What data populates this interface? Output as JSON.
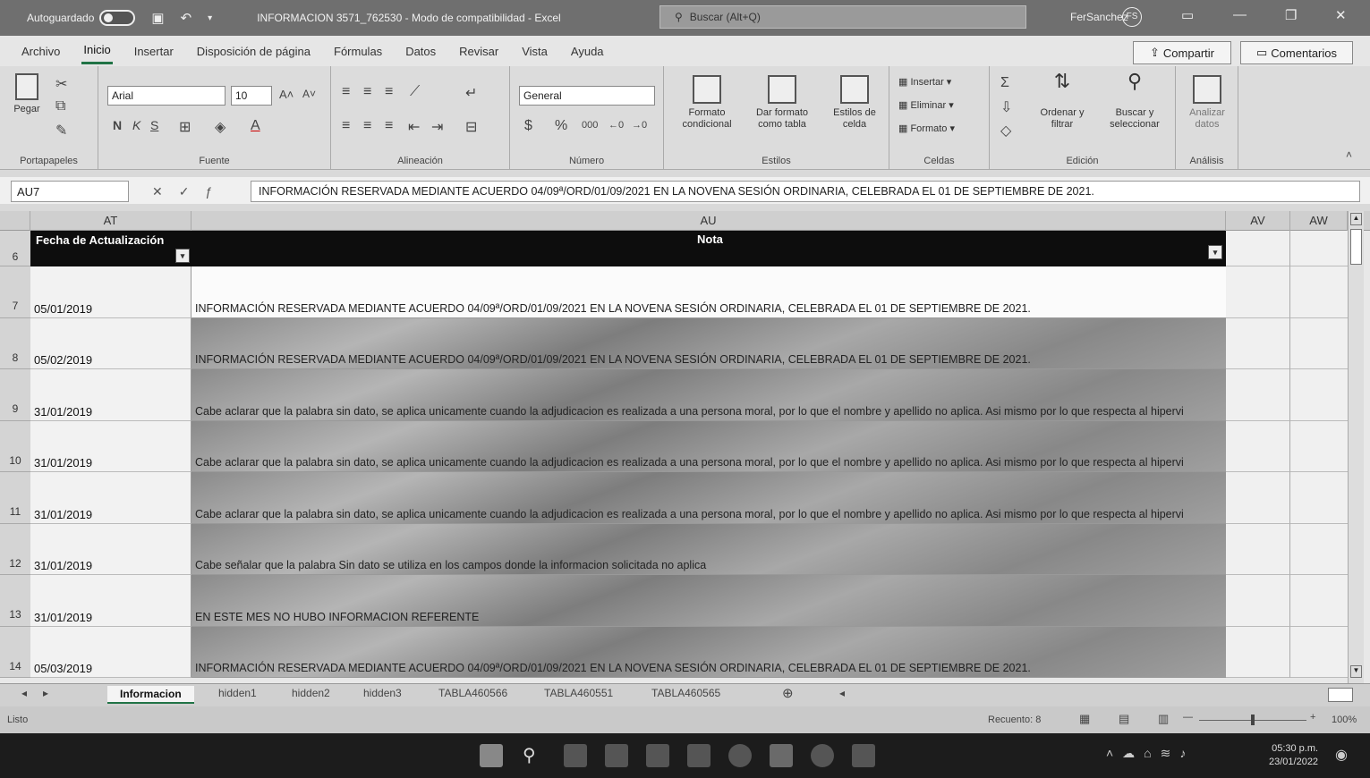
{
  "titlebar": {
    "autosave_label": "Autoguardado",
    "document_title": "INFORMACION 3571_762530 - Modo de compatibilidad - Excel",
    "search_placeholder": "Buscar (Alt+Q)",
    "user_name": "FerSanchez",
    "user_initials": "FS"
  },
  "menu": {
    "tabs": [
      "Archivo",
      "Inicio",
      "Insertar",
      "Disposición de página",
      "Fórmulas",
      "Datos",
      "Revisar",
      "Vista",
      "Ayuda"
    ],
    "active_tab": "Inicio",
    "share_label": "Compartir",
    "comments_label": "Comentarios"
  },
  "ribbon": {
    "clipboard": {
      "paste_label": "Pegar",
      "group_label": "Portapapeles"
    },
    "font": {
      "font_name": "Arial",
      "font_size": "10",
      "bold": "N",
      "italic": "K",
      "underline": "S",
      "group_label": "Fuente"
    },
    "alignment": {
      "group_label": "Alineación"
    },
    "number": {
      "format": "General",
      "group_label": "Número"
    },
    "styles": {
      "conditional_format": "Formato condicional",
      "format_table": "Dar formato como tabla",
      "cell_styles": "Estilos de celda",
      "group_label": "Estilos"
    },
    "cells": {
      "insert": "Insertar",
      "delete": "Eliminar",
      "format": "Formato",
      "group_label": "Celdas"
    },
    "editing": {
      "sort_filter": "Ordenar y filtrar",
      "find_select": "Buscar y seleccionar",
      "group_label": "Edición"
    },
    "analysis": {
      "analyze": "Analizar datos",
      "group_label": "Análisis"
    }
  },
  "formula_bar": {
    "name_box": "AU7",
    "formula": "INFORMACIÓN RESERVADA MEDIANTE ACUERDO 04/09ª/ORD/01/09/2021 EN LA NOVENA SESIÓN ORDINARIA, CELEBRADA EL 01 DE SEPTIEMBRE DE 2021."
  },
  "grid": {
    "columns": [
      "AT",
      "AU",
      "AV",
      "AW"
    ],
    "header_row_number": "6",
    "header_at": "Fecha de Actualización",
    "header_au": "Nota",
    "rows": [
      {
        "num": "7",
        "date": "05/01/2019",
        "note": "INFORMACIÓN RESERVADA MEDIANTE ACUERDO 04/09ª/ORD/01/09/2021 EN LA NOVENA SESIÓN ORDINARIA, CELEBRADA EL 01 DE SEPTIEMBRE DE 2021."
      },
      {
        "num": "8",
        "date": "05/02/2019",
        "note": "INFORMACIÓN RESERVADA MEDIANTE ACUERDO 04/09ª/ORD/01/09/2021 EN LA NOVENA SESIÓN ORDINARIA, CELEBRADA EL 01 DE SEPTIEMBRE DE 2021."
      },
      {
        "num": "9",
        "date": "31/01/2019",
        "note": "Cabe aclarar que la palabra sin dato, se aplica unicamente cuando la adjudicacion es realizada a una persona moral, por lo que el nombre y apellido no aplica. Asi mismo por lo que respecta al hipervi"
      },
      {
        "num": "10",
        "date": "31/01/2019",
        "note": "Cabe aclarar que la palabra sin dato, se aplica unicamente cuando la adjudicacion es realizada a una persona moral, por lo que el nombre y apellido no aplica. Asi mismo por lo que respecta al hipervi"
      },
      {
        "num": "11",
        "date": "31/01/2019",
        "note": "Cabe aclarar que la palabra sin dato, se aplica unicamente cuando la adjudicacion es realizada a una persona moral, por lo que el nombre y apellido no aplica. Asi mismo por lo que respecta al hipervi"
      },
      {
        "num": "12",
        "date": "31/01/2019",
        "note": "Cabe señalar que la palabra Sin dato se utiliza en los campos donde la informacion solicitada no aplica"
      },
      {
        "num": "13",
        "date": "31/01/2019",
        "note": "EN ESTE MES NO HUBO INFORMACION REFERENTE"
      },
      {
        "num": "14",
        "date": "05/03/2019",
        "note": "INFORMACIÓN RESERVADA MEDIANTE ACUERDO 04/09ª/ORD/01/09/2021 EN LA NOVENA SESIÓN ORDINARIA, CELEBRADA EL 01 DE SEPTIEMBRE DE 2021."
      }
    ]
  },
  "sheets": {
    "tabs": [
      "Informacion",
      "hidden1",
      "hidden2",
      "hidden3",
      "TABLA460566",
      "TABLA460551",
      "TABLA460565"
    ],
    "active": "Informacion"
  },
  "status": {
    "ready": "Listo",
    "count": "Recuento: 8",
    "zoom": "100%"
  },
  "taskbar": {
    "time": "05:30 p.m.",
    "date": "23/01/2022"
  }
}
